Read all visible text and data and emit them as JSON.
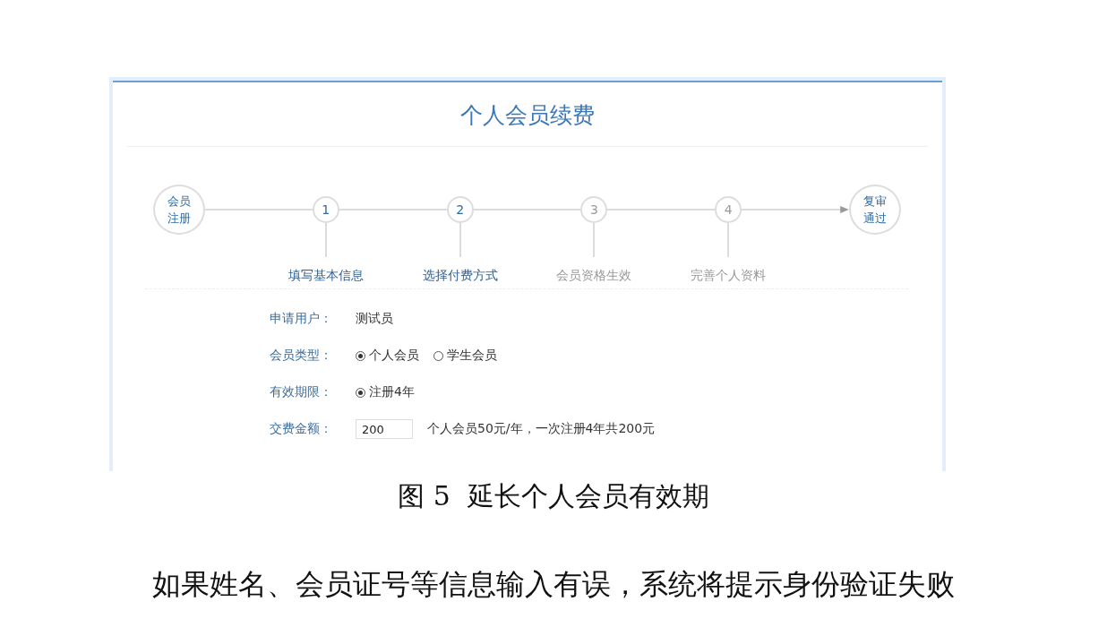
{
  "panel": {
    "title": "个人会员续费",
    "steps": [
      {
        "kind": "start",
        "label": "会员注册",
        "active": true
      },
      {
        "kind": "step",
        "number": "1",
        "label": "填写基本信息",
        "active": true
      },
      {
        "kind": "step",
        "number": "2",
        "label": "选择付费方式",
        "active": true
      },
      {
        "kind": "step",
        "number": "3",
        "label": "会员资格生效",
        "active": false
      },
      {
        "kind": "step",
        "number": "4",
        "label": "完善个人资料",
        "active": false
      },
      {
        "kind": "end",
        "label": "复审通过",
        "active": true
      }
    ],
    "fields": [
      {
        "kind": "text",
        "label": "申请用户：",
        "value": "测试员"
      },
      {
        "kind": "radio",
        "label": "会员类型：",
        "options": [
          {
            "label": "个人会员",
            "selected": true
          },
          {
            "label": "学生会员",
            "selected": false
          }
        ]
      },
      {
        "kind": "radio",
        "label": "有效期限：",
        "options": [
          {
            "label": "注册4年",
            "selected": true
          }
        ]
      },
      {
        "kind": "input",
        "label": "交费金额：",
        "value": "200",
        "note": "个人会员50元/年，一次注册4年共200元"
      }
    ]
  },
  "caption": "图 5  延长个人会员有效期",
  "paragraph": "如果姓名、会员证号等信息输入有误，系统将提示身份验证失败"
}
